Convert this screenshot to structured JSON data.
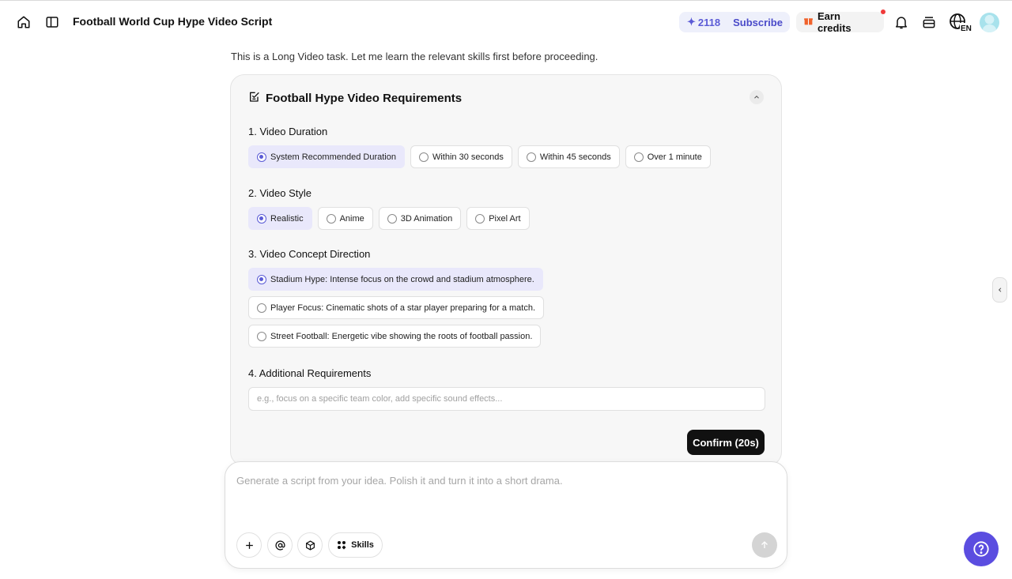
{
  "header": {
    "title": "Football World Cup Hype Video Script",
    "credits": "2118",
    "subscribe_label": "Subscribe",
    "earn_label": "Earn credits",
    "language": "EN"
  },
  "intro_text": "This is a Long Video task. Let me learn the relevant skills first before proceeding.",
  "card": {
    "title": "Football Hype Video Requirements",
    "sections": [
      {
        "title": "1. Video Duration",
        "options": [
          {
            "label": "System Recommended Duration",
            "selected": true
          },
          {
            "label": "Within 30 seconds",
            "selected": false
          },
          {
            "label": "Within 45 seconds",
            "selected": false
          },
          {
            "label": "Over 1 minute",
            "selected": false
          }
        ]
      },
      {
        "title": "2. Video Style",
        "options": [
          {
            "label": "Realistic",
            "selected": true
          },
          {
            "label": "Anime",
            "selected": false
          },
          {
            "label": "3D Animation",
            "selected": false
          },
          {
            "label": "Pixel Art",
            "selected": false
          }
        ]
      },
      {
        "title": "3. Video Concept Direction",
        "options": [
          {
            "label": "Stadium Hype: Intense focus on the crowd and stadium atmosphere.",
            "selected": true
          },
          {
            "label": "Player Focus: Cinematic shots of a star player preparing for a match.",
            "selected": false
          },
          {
            "label": "Street Football: Energetic vibe showing the roots of football passion.",
            "selected": false
          }
        ]
      },
      {
        "title": "4. Additional Requirements",
        "placeholder": "e.g., focus on a specific team color, add specific sound effects...",
        "value": ""
      }
    ],
    "confirm_label": "Confirm (20s)"
  },
  "composer": {
    "placeholder": "Generate a script from your idea. Polish it and turn it into a short drama.",
    "value": "",
    "skills_label": "Skills"
  },
  "colors": {
    "accent": "#5b5bd6",
    "help_button": "#5b4de0",
    "selected_bg": "#e9e8fb",
    "notification_dot": "#f03a3a"
  },
  "icons": [
    "home-icon",
    "sidebar-toggle-icon",
    "sparkle-icon",
    "gift-icon",
    "bell-icon",
    "layers-icon",
    "globe-icon",
    "checklist-icon",
    "chevron-up-icon",
    "chevron-left-icon",
    "plus-icon",
    "at-icon",
    "cube-icon",
    "skills-grid-icon",
    "arrow-up-icon",
    "help-icon"
  ]
}
